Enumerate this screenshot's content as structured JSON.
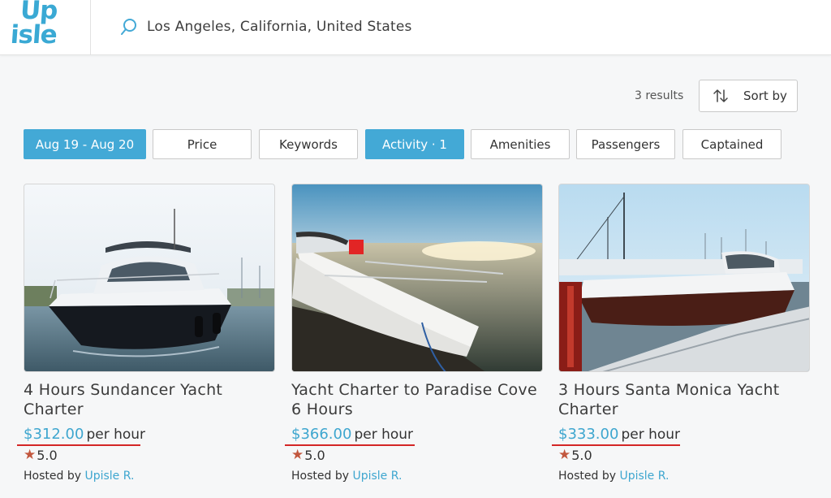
{
  "logo": {
    "line1": "Up",
    "line2": "isle"
  },
  "search": {
    "location": "Los Angeles, California, United States"
  },
  "results": {
    "count_text": "3 results",
    "sort_label": "Sort by"
  },
  "filters": [
    {
      "label": "Aug 19 - Aug 20",
      "active": true
    },
    {
      "label": "Price",
      "active": false
    },
    {
      "label": "Keywords",
      "active": false
    },
    {
      "label": "Activity · 1",
      "active": true
    },
    {
      "label": "Amenities",
      "active": false
    },
    {
      "label": "Passengers",
      "active": false
    },
    {
      "label": "Captained",
      "active": false
    }
  ],
  "listings": [
    {
      "title": "4 Hours Sundancer Yacht Charter",
      "price": "$312.00",
      "unit": "per hour",
      "rating": "5.0",
      "hosted_by": "Hosted by",
      "host": "Upisle R."
    },
    {
      "title": "Yacht Charter to Paradise Cove 6 Hours",
      "price": "$366.00",
      "unit": "per hour",
      "rating": "5.0",
      "hosted_by": "Hosted by",
      "host": "Upisle R."
    },
    {
      "title": "3 Hours Santa Monica Yacht Charter",
      "price": "$333.00",
      "unit": "per hour",
      "rating": "5.0",
      "hosted_by": "Hosted by",
      "host": "Upisle R."
    }
  ],
  "colors": {
    "accent": "#43a9d6",
    "price": "#3ea6cf",
    "star": "#c2573e",
    "annotation_underline": "#d42626"
  },
  "icons": {
    "search": "search-icon",
    "sort": "sort-arrows-icon",
    "star": "star-icon"
  }
}
